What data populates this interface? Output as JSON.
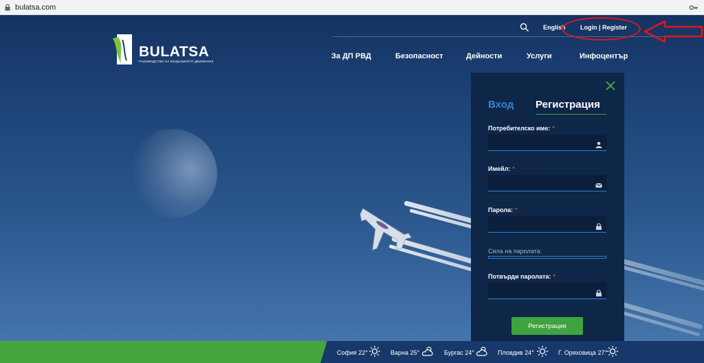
{
  "browser": {
    "url": "bulatsa.com"
  },
  "header": {
    "logo_text": "BULATSA",
    "logo_subtitle": "РЪКОВОДСТВО НА ВЪЗДУШНОТО ДВИЖЕНИЕ",
    "language": "English",
    "login_register": "Login | Register",
    "nav": [
      "За ДП РВД",
      "Безопасност",
      "Дейности",
      "Услуги",
      "Инфоцентър"
    ]
  },
  "panel": {
    "tab_login": "Вход",
    "tab_register": "Регистрация",
    "username_label": "Потребителско име:",
    "email_label": "Имейл:",
    "password_label": "Парола:",
    "strength_label": "Сила на паролата:",
    "confirm_label": "Потвърди паролата:",
    "required_mark": "*",
    "submit": "Регистрация"
  },
  "weather": [
    {
      "city": "София",
      "temp": "22°",
      "icon": "sun-icon"
    },
    {
      "city": "Варна",
      "temp": "25°",
      "icon": "partly-cloudy-icon"
    },
    {
      "city": "Бургас",
      "temp": "24°",
      "icon": "partly-cloudy-icon"
    },
    {
      "city": "Пловдив",
      "temp": "24°",
      "icon": "sun-icon"
    },
    {
      "city": "Г. Оряховица",
      "temp": "27°",
      "icon": "sun-icon"
    }
  ],
  "colors": {
    "accent_green": "#43a63a",
    "panel_bg": "#0e2648",
    "tab_active_blue": "#2f86d6",
    "annotation_red": "#e01818"
  }
}
